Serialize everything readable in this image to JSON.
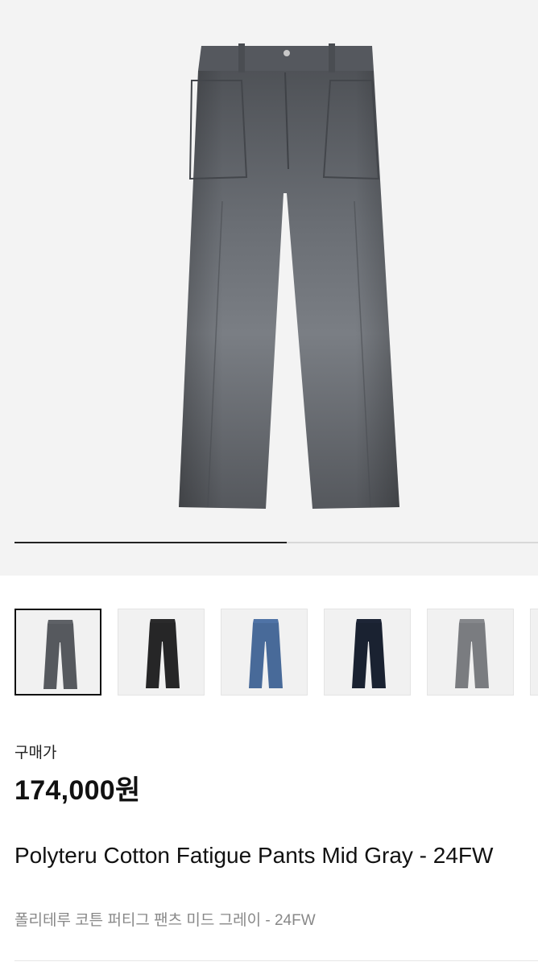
{
  "gallery": {
    "main_image": "pants-photo-mid-gray",
    "progress": 0.52
  },
  "thumbnails": [
    {
      "name": "mid-gray",
      "color": "#5e6166",
      "selected": true
    },
    {
      "name": "black",
      "color": "#2a2a2b",
      "selected": false
    },
    {
      "name": "blue",
      "color": "#4f73a6",
      "selected": false
    },
    {
      "name": "navy",
      "color": "#1d2536",
      "selected": false
    },
    {
      "name": "light-gray",
      "color": "#85878b",
      "selected": false
    }
  ],
  "product": {
    "price_label": "구매가",
    "price": "174,000원",
    "name_en": "Polyteru Cotton Fatigue Pants Mid Gray - 24FW",
    "name_kr": "폴리테루 코튼 퍼티그 팬츠 미드 그레이 - 24FW"
  }
}
